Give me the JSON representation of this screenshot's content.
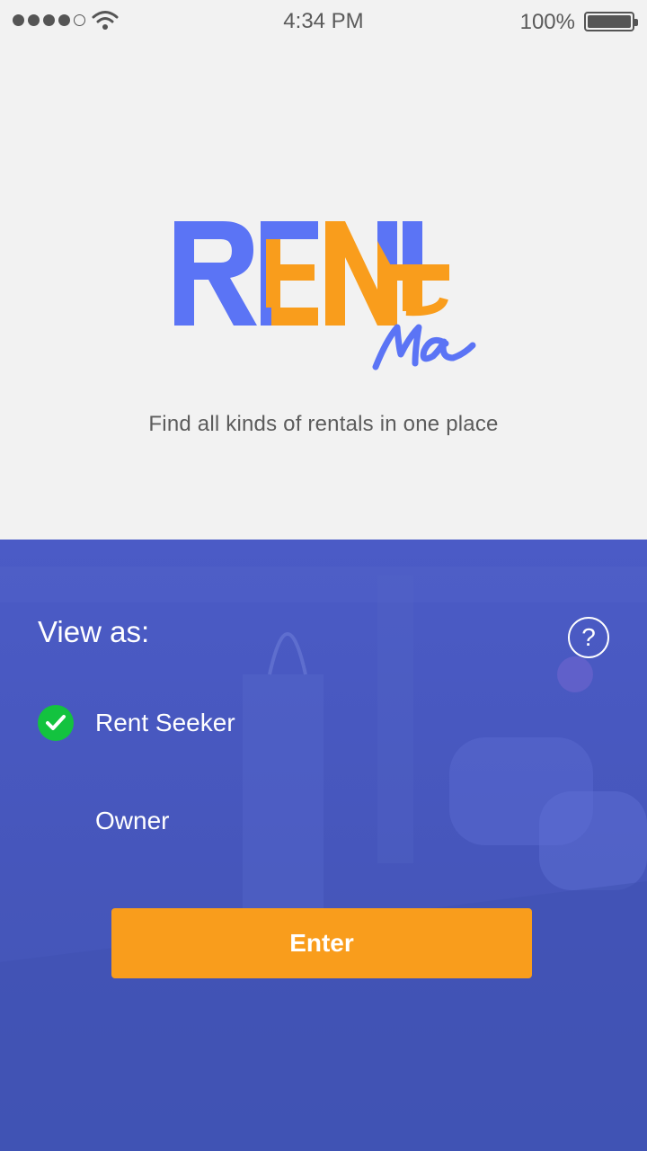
{
  "status_bar": {
    "time": "4:34 PM",
    "battery_percent": "100%",
    "signal_icon": "signal-dots-icon",
    "wifi_icon": "wifi-icon",
    "battery_icon": "battery-icon"
  },
  "brand": {
    "logo_text": "RENTMa",
    "tagline": "Find all kinds of rentals in one place",
    "colors": {
      "blue": "#5b74f5",
      "orange": "#f99d1c"
    }
  },
  "role_picker": {
    "heading": "View as:",
    "help_label": "?",
    "options": [
      {
        "label": "Rent Seeker",
        "selected": true
      },
      {
        "label": "Owner",
        "selected": false
      }
    ],
    "enter_label": "Enter"
  },
  "colors": {
    "panel": "#4656bb",
    "accent_button": "#f99d1c",
    "check_green": "#13c33f",
    "background": "#f2f2f2"
  }
}
